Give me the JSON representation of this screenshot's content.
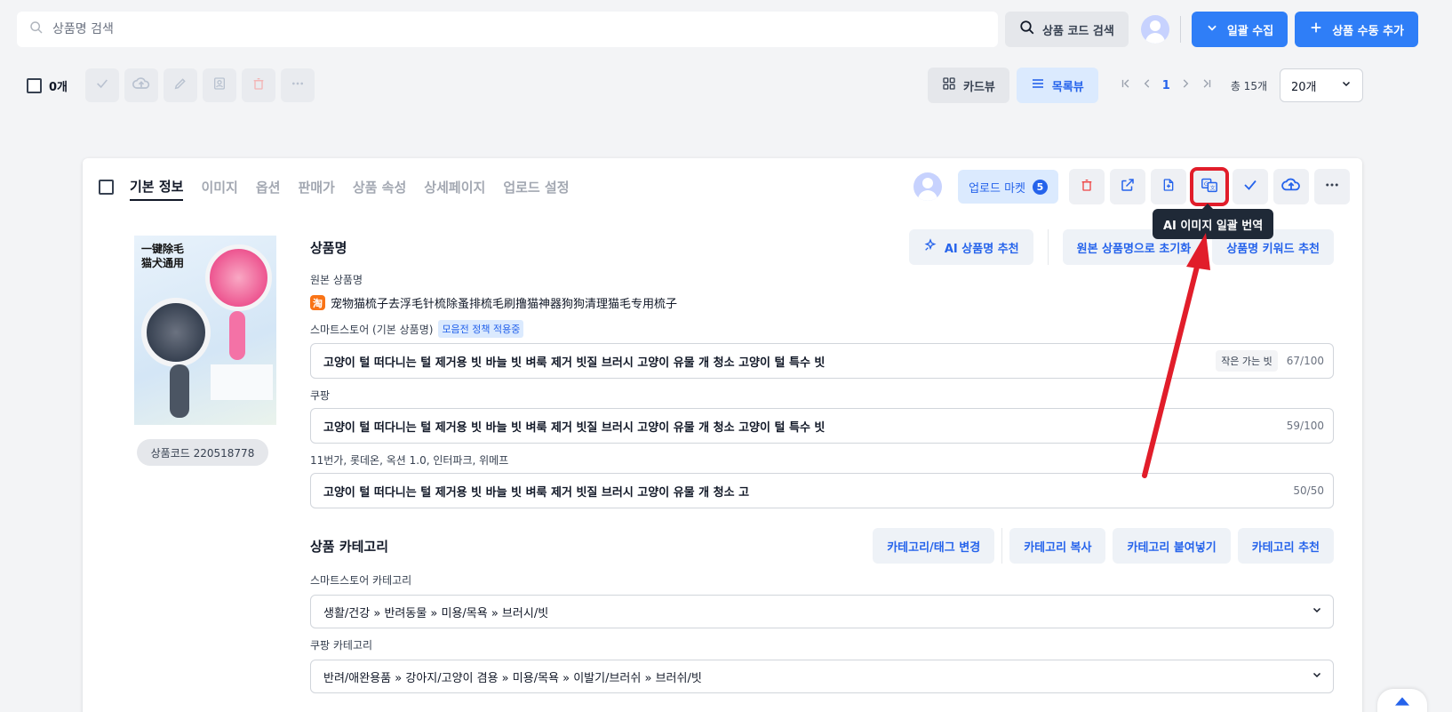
{
  "search": {
    "placeholder": "상품명 검색"
  },
  "top": {
    "code_search_label": "상품 코드 검색",
    "bulk_collect_label": "일괄 수집",
    "manual_add_label": "상품 수동 추가"
  },
  "toolbar": {
    "count_label": "0개",
    "card_view_label": "카드뷰",
    "list_view_label": "목록뷰",
    "current_page": "1",
    "total_label": "총 15개",
    "page_size": "20개"
  },
  "card": {
    "tabs": [
      {
        "label": "기본 정보"
      },
      {
        "label": "이미지"
      },
      {
        "label": "옵션"
      },
      {
        "label": "판매가"
      },
      {
        "label": "상품 속성"
      },
      {
        "label": "상세페이지"
      },
      {
        "label": "업로드 설정"
      }
    ],
    "upload_market_label": "업로드 마켓",
    "upload_market_count": "5",
    "tooltip": "AI 이미지 일괄 번역",
    "image": {
      "overlay_text_line1": "一键除毛",
      "overlay_text_line2": "猫犬通用"
    },
    "product_code": "상품코드 220518778",
    "name_section": {
      "title": "상품명",
      "ai_recommend_label": "AI 상품명 추천",
      "reset_label": "원본 상품명으로 초기화",
      "keyword_label": "상품명 키워드 추천",
      "original_label": "원본 상품명",
      "source_icon": "淘",
      "original_name": "宠物猫梳子去浮毛针梳除蚤排梳毛刷撸猫神器狗狗清理猫毛专用梳子",
      "smartstore_label": "스마트스토어 (기본 상품명)",
      "policy_tag": "모음전 정책 적용중",
      "smartstore_value": "고양이 털 떠다니는 털 제거용 빗 바늘 빗 벼룩 제거 빗질 브러시 고양이 유물 개 청소 고양이 털 특수 빗",
      "smartstore_warn": "작은 가는 빗",
      "smartstore_count": "67/100",
      "coupang_label": "쿠팡",
      "coupang_value": "고양이 털 떠다니는 털 제거용 빗 바늘 빗 벼룩 제거 빗질 브러시 고양이 유물 개 청소 고양이 털 특수 빗",
      "coupang_count": "59/100",
      "eleven_label": "11번가, 롯데온, 옥션 1.0, 인터파크, 위메프",
      "eleven_value": "고양이 털 떠다니는 털 제거용 빗 바늘 빗 벼룩 제거 빗질 브러시 고양이 유물 개 청소 고",
      "eleven_count": "50/50"
    },
    "category_section": {
      "title": "상품 카테고리",
      "change_label": "카테고리/태그 변경",
      "copy_label": "카테고리 복사",
      "paste_label": "카테고리 붙여넣기",
      "recommend_label": "카테고리 추천",
      "smartstore_label": "스마트스토어 카테고리",
      "smartstore_value": "생활/건강 » 반려동물 » 미용/목욕 » 브러시/빗",
      "coupang_label": "쿠팡 카테고리",
      "coupang_value": "반려/애완용품 » 강아지/고양이 겸용 » 미용/목욕 » 이발기/브러쉬 » 브러쉬/빗"
    }
  },
  "colors": {
    "accent": "#2f7ef7",
    "highlight": "#e11d2a"
  },
  "icons": [
    "search-icon",
    "magnifier-icon",
    "chevron-down-icon",
    "plus-icon",
    "check-icon",
    "cloud-upload-icon",
    "pencil-icon",
    "contact-icon",
    "trash-icon",
    "more-icon",
    "grid-icon",
    "list-icon",
    "first-page-icon",
    "prev-page-icon",
    "next-page-icon",
    "last-page-icon",
    "external-link-icon",
    "file-add-icon",
    "translate-icon",
    "sparkle-icon",
    "arrow-up-icon"
  ]
}
